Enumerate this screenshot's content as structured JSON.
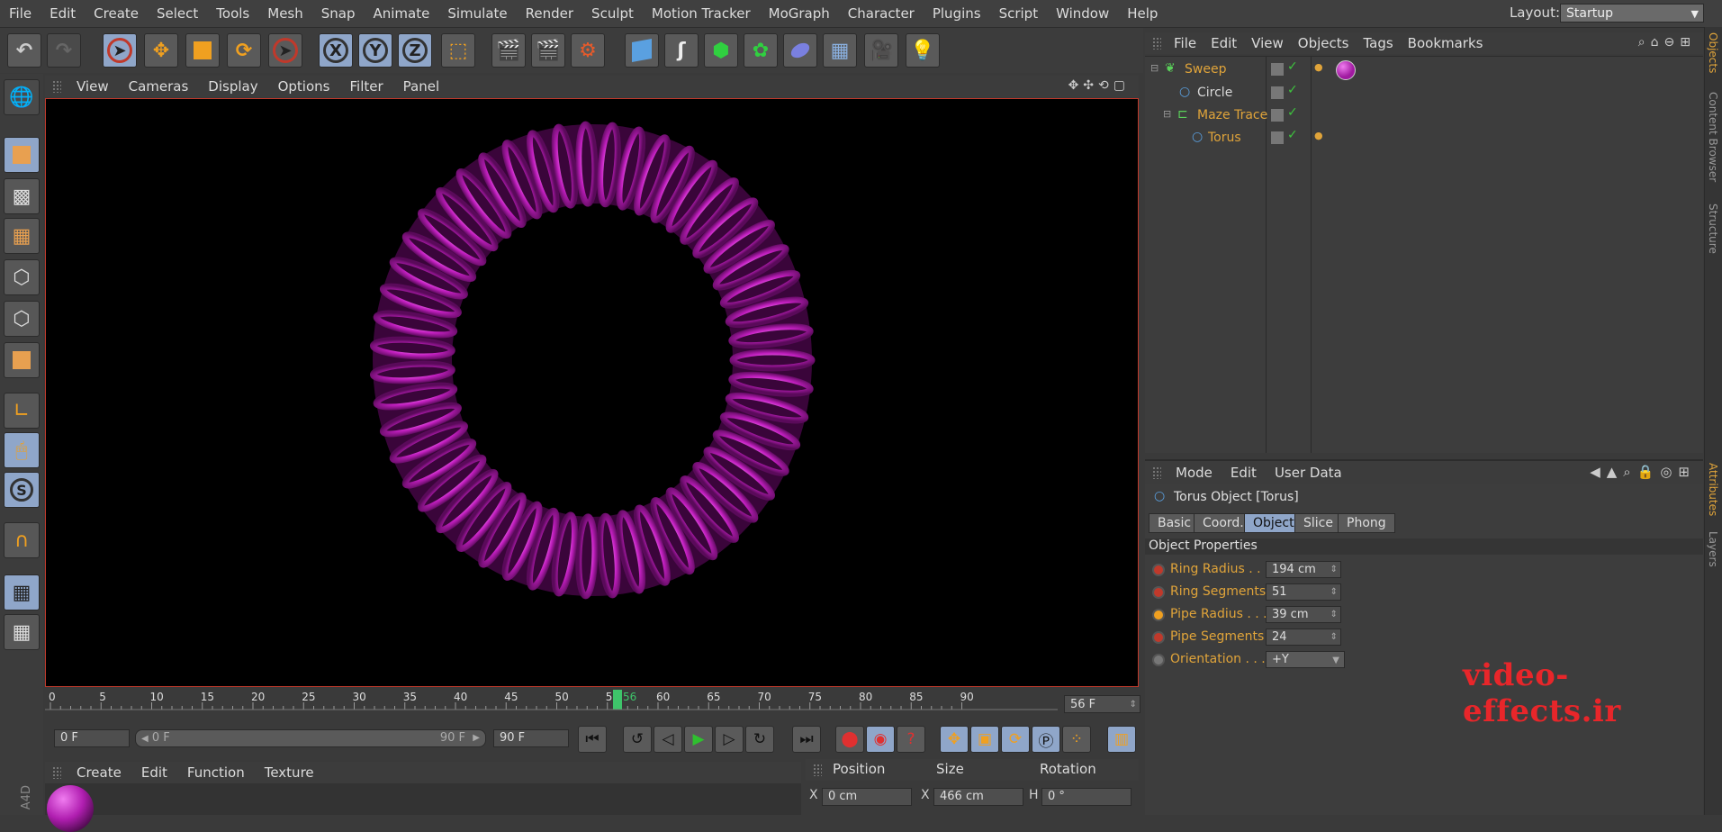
{
  "menubar": {
    "items": [
      "File",
      "Edit",
      "Create",
      "Select",
      "Tools",
      "Mesh",
      "Snap",
      "Animate",
      "Simulate",
      "Render",
      "Sculpt",
      "Motion Tracker",
      "MoGraph",
      "Character",
      "Plugins",
      "Script",
      "Window",
      "Help"
    ],
    "layout_label": "Layout:",
    "layout_value": "Startup"
  },
  "toolbar": {
    "axis_x": "X",
    "axis_y": "Y",
    "axis_z": "Z"
  },
  "left_toolbar": {
    "snap_label": "S"
  },
  "viewport": {
    "menu": [
      "View",
      "Cameras",
      "Display",
      "Options",
      "Filter",
      "Panel"
    ],
    "object_color": "#c21fc0"
  },
  "timeline": {
    "ticks": [
      "0",
      "5",
      "10",
      "15",
      "20",
      "25",
      "30",
      "35",
      "40",
      "45",
      "50",
      "55",
      "60",
      "65",
      "70",
      "75",
      "80",
      "85",
      "90"
    ],
    "current_marker": "56",
    "current_frame": "56 F",
    "start_field": "0 F",
    "range_start": "0 F",
    "range_end": "90 F",
    "end_field": "90 F"
  },
  "material_manager": {
    "menu": [
      "Create",
      "Edit",
      "Function",
      "Texture"
    ]
  },
  "coordinates": {
    "headers": [
      "Position",
      "Size",
      "Rotation"
    ],
    "x_label": "X",
    "x_pos": "0 cm",
    "x_size_label": "X",
    "x_size": "466 cm",
    "h_label": "H",
    "h_rot": "0 °"
  },
  "object_manager": {
    "menu": [
      "File",
      "Edit",
      "View",
      "Objects",
      "Tags",
      "Bookmarks"
    ],
    "objects": [
      {
        "name": "Sweep",
        "color": "#e0a43a",
        "indent": 0
      },
      {
        "name": "Circle",
        "color": "#d8d8d8",
        "indent": 1
      },
      {
        "name": "Maze Trace",
        "color": "#e0a43a",
        "indent": 0
      },
      {
        "name": "Torus",
        "color": "#e0a43a",
        "indent": 1
      }
    ]
  },
  "attribute_manager": {
    "menu": [
      "Mode",
      "Edit",
      "User Data"
    ],
    "object_title": "Torus Object [Torus]",
    "tabs": [
      "Basic",
      "Coord.",
      "Object",
      "Slice",
      "Phong"
    ],
    "active_tab": "Object",
    "section": "Object Properties",
    "properties": [
      {
        "label": "Ring Radius . . .",
        "value": "194 cm"
      },
      {
        "label": "Ring Segments",
        "value": "51"
      },
      {
        "label": "Pipe Radius . . .",
        "value": "39 cm"
      },
      {
        "label": "Pipe Segments",
        "value": "24"
      },
      {
        "label": "Orientation . . .",
        "value": "+Y"
      }
    ]
  },
  "side_tabs": [
    "Objects",
    "Content Browser",
    "Structure",
    "Attributes",
    "Layers"
  ],
  "watermark": "video-effects.ir",
  "corner_label": "A4D"
}
